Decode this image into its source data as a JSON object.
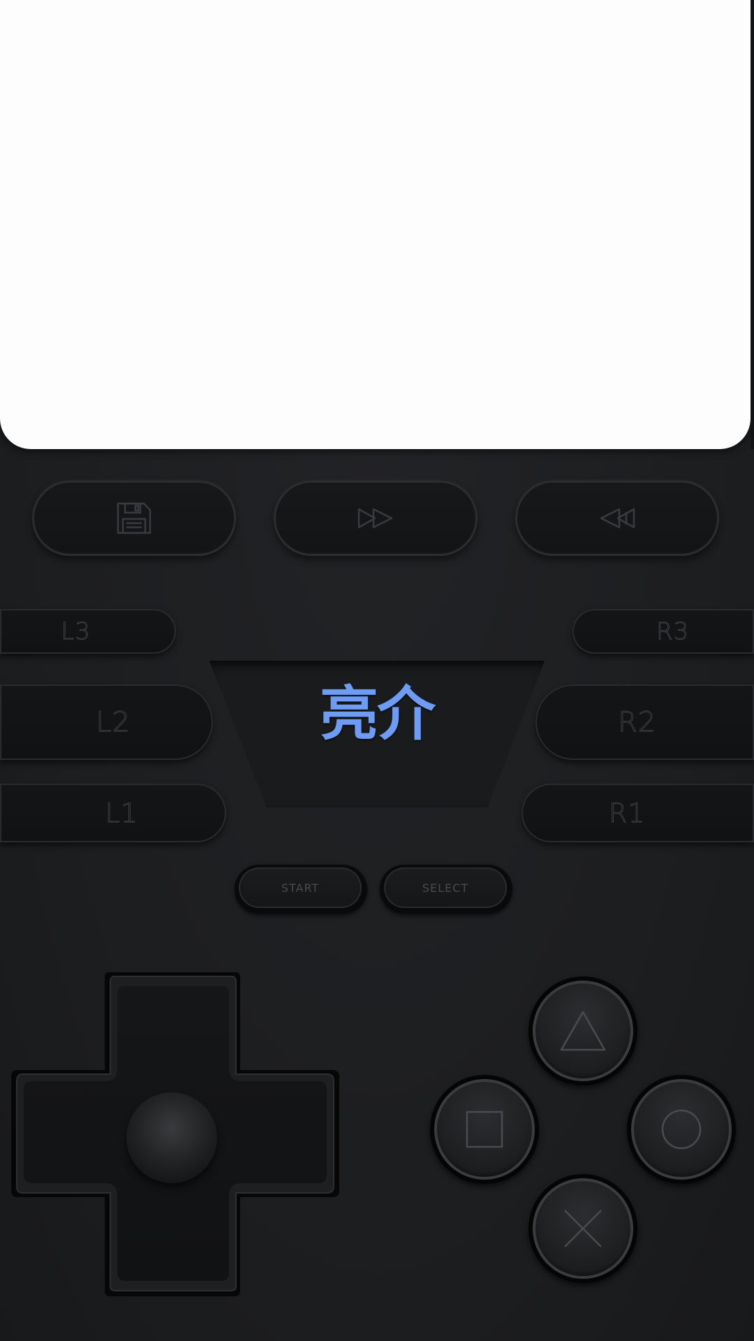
{
  "screen": {
    "state": "blank"
  },
  "quick_actions": [
    {
      "id": "save",
      "icon": "floppy-disk-icon"
    },
    {
      "id": "fast_forward",
      "icon": "fast-forward-icon"
    },
    {
      "id": "rewind",
      "icon": "rewind-icon"
    }
  ],
  "shoulders": {
    "l3": "L3",
    "l2": "L2",
    "l1": "L1",
    "r3": "R3",
    "r2": "R2",
    "r1": "R1"
  },
  "brand": {
    "text": "亮介",
    "color": "#6e9bf4"
  },
  "system_buttons": {
    "start": "START",
    "select": "SELECT"
  },
  "dpad": {
    "icon": "dpad-icon",
    "stick_icon": "analog-stick-icon"
  },
  "face_buttons": [
    {
      "id": "triangle",
      "icon": "triangle-icon"
    },
    {
      "id": "square",
      "icon": "square-icon"
    },
    {
      "id": "circle",
      "icon": "circle-icon"
    },
    {
      "id": "cross",
      "icon": "cross-icon"
    }
  ],
  "colors": {
    "body": "#1d1e20",
    "screen": "#fdfdfd",
    "accent": "#6e9bf4"
  }
}
